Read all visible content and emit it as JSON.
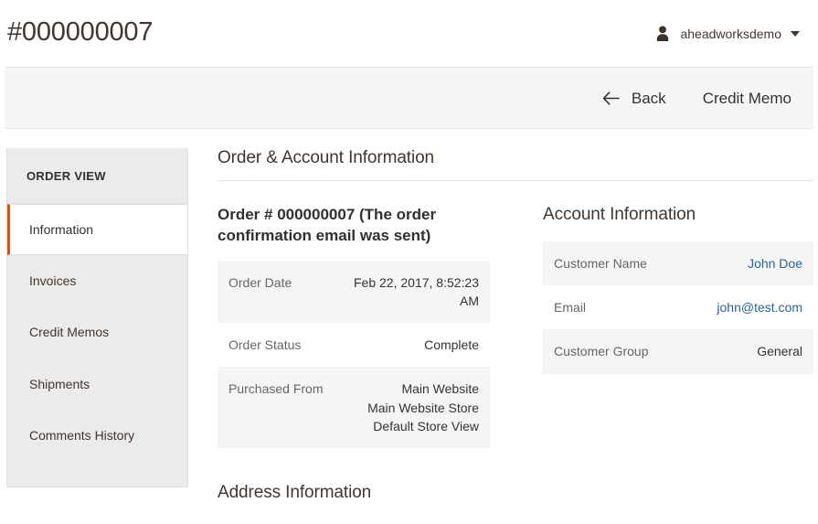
{
  "header": {
    "title": "#000000007",
    "user": {
      "avatar_icon": "user-avatar-icon",
      "name": "aheadworksdemo",
      "caret_icon": "chevron-down-icon"
    }
  },
  "toolbar": {
    "back_icon": "arrow-left-icon",
    "back_label": "Back",
    "credit_memo_label": "Credit Memo"
  },
  "sidebar": {
    "title": "ORDER VIEW",
    "items": [
      {
        "label": "Information",
        "active": true
      },
      {
        "label": "Invoices",
        "active": false
      },
      {
        "label": "Credit Memos",
        "active": false
      },
      {
        "label": "Shipments",
        "active": false
      },
      {
        "label": "Comments History",
        "active": false
      }
    ]
  },
  "content": {
    "section_title": "Order & Account Information",
    "order_block": {
      "title": "Order # 000000007 (The order confirmation email was sent)",
      "rows": [
        {
          "label": "Order Date",
          "value": "Feb 22, 2017, 8:52:23 AM",
          "link": false
        },
        {
          "label": "Order Status",
          "value": "Complete",
          "link": false
        },
        {
          "label": "Purchased From",
          "value_lines": [
            "Main Website",
            "Main Website Store",
            "Default Store View"
          ],
          "link": false
        }
      ]
    },
    "account_block": {
      "title": "Account Information",
      "rows": [
        {
          "label": "Customer Name",
          "value": "John Doe",
          "link": true
        },
        {
          "label": "Email",
          "value": "john@test.com",
          "link": true
        },
        {
          "label": "Customer Group",
          "value": "General",
          "link": false
        }
      ]
    },
    "address_section_title": "Address Information"
  },
  "colors": {
    "accent_orange": "#e04e0b",
    "link_blue": "#2a6496",
    "text_dark": "#41362f",
    "row_shade": "#f5f5f5",
    "toolbar_bg": "#f5f5f5"
  }
}
